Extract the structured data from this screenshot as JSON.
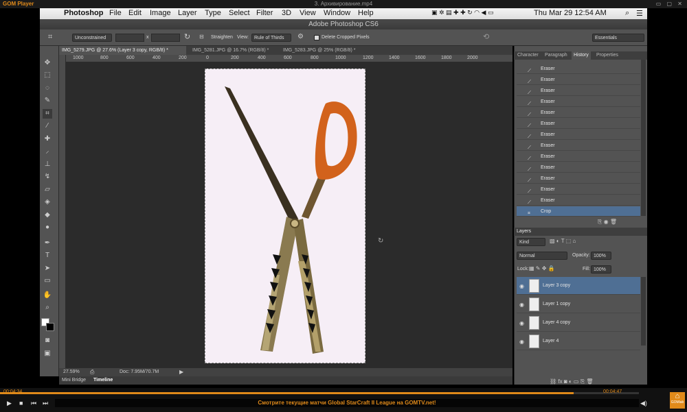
{
  "player": {
    "app_name": "GOM Player",
    "file_name": "3. Архивирование.mp4",
    "time_current": "00:04:34",
    "time_total": "00:04:47",
    "progress": 0.956,
    "marquee": "Смотрите текущие матчи Global StarCraft II League на GOMTV.net!",
    "badge": "GOMlab"
  },
  "menubar": {
    "app": "Photoshop",
    "items": [
      "File",
      "Edit",
      "Image",
      "Layer",
      "Type",
      "Select",
      "Filter",
      "3D",
      "View",
      "Window",
      "Help"
    ],
    "clock": "Thu Mar 29  12:54 AM"
  },
  "window_title": "Adobe Photoshop CS6",
  "options": {
    "ratio": "Unconstrained",
    "x_sep": "x",
    "straighten": "Straighten",
    "view_label": "View:",
    "view_value": "Rule of Thirds",
    "delete_cropped": "Delete Cropped Pixels",
    "workspace": "Essentials"
  },
  "tabs": [
    {
      "label": "IMG_5279.JPG @ 27.6% (Layer 3 copy, RGB/8) *",
      "active": true
    },
    {
      "label": "IMG_5281.JPG @ 16.7% (RGB/8) *",
      "active": false
    },
    {
      "label": "IMG_5283.JPG @ 25% (RGB/8) *",
      "active": false
    }
  ],
  "ruler_ticks": [
    "1000",
    "800",
    "600",
    "400",
    "200",
    "0",
    "200",
    "400",
    "600",
    "800",
    "1000",
    "1200",
    "1400",
    "1600",
    "1800",
    "2000"
  ],
  "status": {
    "zoom": "27.59%",
    "doc": "Doc: 7.95M/70.7M"
  },
  "bottom_tabs": [
    "Mini Bridge",
    "Timeline"
  ],
  "panel_tabs": [
    "Character",
    "Paragraph",
    "History",
    "Properties"
  ],
  "history": [
    "Eraser",
    "Eraser",
    "Eraser",
    "Eraser",
    "Eraser",
    "Eraser",
    "Eraser",
    "Eraser",
    "Eraser",
    "Eraser",
    "Eraser",
    "Eraser",
    "Eraser",
    "Crop"
  ],
  "layers_panel": {
    "title": "Layers",
    "kind": "Kind",
    "blend": "Normal",
    "opacity_label": "Opacity:",
    "opacity": "100%",
    "lock_label": "Lock:",
    "fill_label": "Fill:",
    "fill": "100%",
    "layers": [
      "Layer 3 copy",
      "Layer 1 copy",
      "Layer 4 copy",
      "Layer 4"
    ]
  },
  "colors": {
    "accent": "#e08a1a",
    "selection": "#4f6f94",
    "panel": "#535353"
  }
}
